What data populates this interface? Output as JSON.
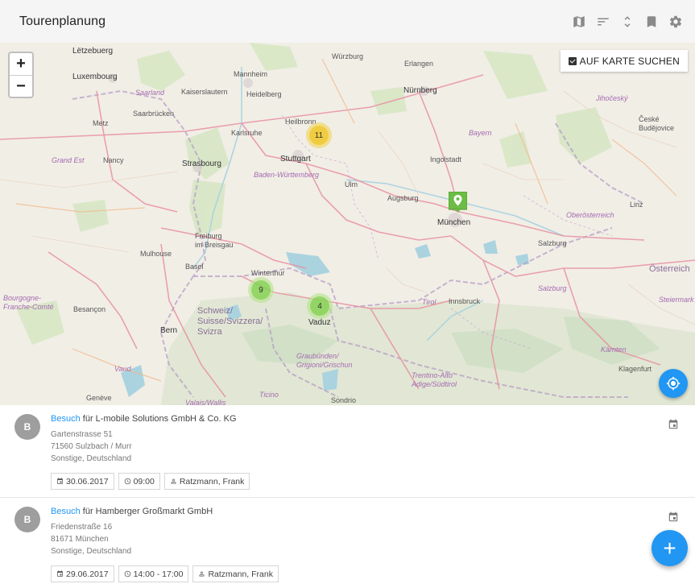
{
  "header": {
    "title": "Tourenplanung",
    "tools": [
      "map-icon",
      "sort-icon",
      "unfold-icon",
      "bookmark-icon",
      "settings-icon"
    ]
  },
  "map": {
    "zoom_in": "+",
    "zoom_out": "−",
    "search_on_map_label": "AUF KARTE SUCHEN",
    "search_on_map_checked": true,
    "clusters": [
      {
        "count": "11",
        "color": "yellow"
      },
      {
        "count": "9",
        "color": "green"
      },
      {
        "count": "4",
        "color": "green"
      }
    ],
    "marker": {
      "color": "#6cbd45",
      "place": "München"
    },
    "labels": {
      "letzebuerg": "Lëtzebuerg",
      "luxembourg": "Luxembourg",
      "saarland": "Saarland",
      "kaiserslautern": "Kaiserslautern",
      "saarbruecken": "Saarbrücken",
      "mannheim": "Mannheim",
      "heidelberg": "Heidelberg",
      "heilbronn": "Heilbronn",
      "wuerzburg": "Würzburg",
      "erlangen": "Erlangen",
      "nuernberg": "Nürnberg",
      "metz": "Metz",
      "karlsruhe": "Karlsruhe",
      "nancy": "Nancy",
      "grand_est": "Grand Est",
      "strasbourg": "Strasbourg",
      "stuttgart": "Stuttgart",
      "bw": "Baden-Württemberg",
      "ingolstadt": "Ingolstadt",
      "bayern": "Bayern",
      "ulm": "Ulm",
      "augsburg": "Augsburg",
      "muenchen": "München",
      "oberoesterreich": "Oberösterreich",
      "linz": "Linz",
      "freiburg": "Freiburg\nim Breisgau",
      "mulhouse": "Mulhouse",
      "basel": "Basel",
      "winterthur": "Winterthur",
      "salzburg_city": "Salzburg",
      "salzburg_region": "Salzburg",
      "oesterreich": "Österreich",
      "steiermark": "Steiermark",
      "bourgogne": "Bourgogne-\nFranche-Comté",
      "besancon": "Besançon",
      "schweiz": "Schweiz/\nSuisse/Svizzera/\nSvizra",
      "vaduz": "Vaduz",
      "tirol": "Tirol",
      "innsbruck": "Innsbruck",
      "bern": "Bern",
      "graubuenden": "Graubünden/\nGrigioni/Grischun",
      "trentino": "Trentino-Alto\nAdige/Südtirol",
      "kaernten": "Kärnten",
      "klagenfurt": "Klagenfurt",
      "vaud": "Vaud",
      "ticino": "Ticino",
      "valais": "Valais/Wallis",
      "geneve": "Genève",
      "sondrio": "Sondrio",
      "jihocesky": "Jihočeský",
      "ceske": "České\nBudějovice"
    }
  },
  "list": {
    "items": [
      {
        "avatar": "B",
        "type": "Besuch",
        "connector": "für",
        "company": "L-mobile Solutions GmbH & Co. KG",
        "street": "Gartenstrasse 51",
        "city": "71560 Sulzbach / Murr",
        "country": "Sonstige, Deutschland",
        "date": "30.06.2017",
        "time": "09:00",
        "person": "Ratzmann, Frank"
      },
      {
        "avatar": "B",
        "type": "Besuch",
        "connector": "für",
        "company": "Hamberger Großmarkt GmbH",
        "street": "Friedenstraße 16",
        "city": "81671 München",
        "country": "Sonstige, Deutschland",
        "date": "29.06.2017",
        "time": "14:00 - 17:00",
        "person": "Ratzmann, Frank"
      }
    ]
  },
  "fab": {
    "label": "+"
  },
  "colors": {
    "accent": "#2196f3",
    "header_bg": "#f5f5f5",
    "map_land": "#f1eee6",
    "cluster_yellow": "#f0c20c",
    "cluster_green": "#6ecc39",
    "marker_green": "#6cbd45"
  }
}
